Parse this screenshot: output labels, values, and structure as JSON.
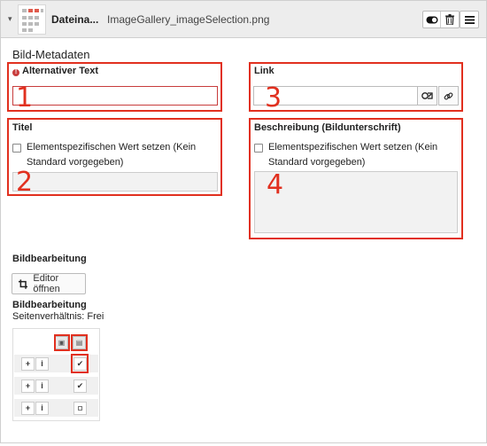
{
  "header": {
    "caret": "▾",
    "type_label": "Dateina...",
    "filename": "ImageGallery_imageSelection.png",
    "toggle_icon": "toggle-icon",
    "delete_icon": "trash-icon",
    "menu_icon": "hamburger-icon"
  },
  "section": {
    "title": "Bild-Metadaten"
  },
  "fields": {
    "alt_text": {
      "label": "Alternativer Text",
      "required_icon": "!",
      "value": "",
      "marker": "1"
    },
    "link": {
      "label": "Link",
      "value": "",
      "marker": "3",
      "browse_icon": "link-browser-icon",
      "link_icon": "chain-icon"
    },
    "title": {
      "label": "Titel",
      "checkbox_label": "Elementspezifischen Wert setzen (Kein Standard vorgegeben)",
      "value": "",
      "marker": "2"
    },
    "description": {
      "label": "Beschreibung (Bildunterschrift)",
      "checkbox_label": "Elementspezifischen Wert setzen (Kein Standard vorgegeben)",
      "value": "",
      "marker": "4"
    }
  },
  "editing": {
    "heading": "Bildbearbeitung",
    "editor_button": "Editor öffnen",
    "heading2": "Bildbearbeitung",
    "aspect_label": "Seitenverhältnis: Frei"
  },
  "variants": {
    "rows": [
      {
        "plus": "+",
        "info": "i",
        "state": "✔"
      },
      {
        "plus": "+",
        "info": "i",
        "state": "✔"
      },
      {
        "plus": "+",
        "info": "i",
        "state": ""
      }
    ]
  }
}
